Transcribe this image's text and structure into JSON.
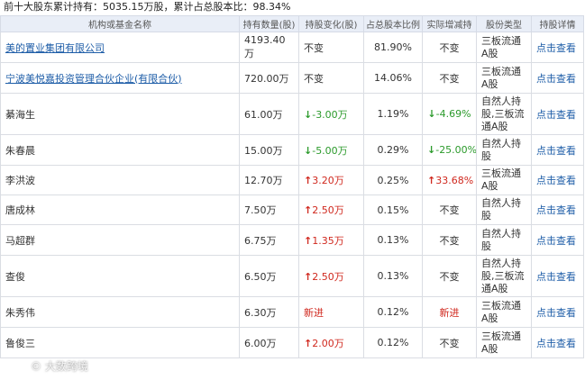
{
  "summary": {
    "title": "前十大股东累计持有：5035.15万股，累计占总股本比：98.34%"
  },
  "table": {
    "headers": [
      "机构或基金名称",
      "持有数量(股)",
      "持股变化(股)",
      "占总股本比例",
      "实际增减持",
      "股份类型",
      "持股详情"
    ],
    "rows": [
      {
        "name": "美的置业集团有限公司",
        "name_link": true,
        "qty": "4193.40万",
        "change": "不变",
        "change_dir": "none",
        "pct": "81.90%",
        "real": "不变",
        "real_dir": "none",
        "type": "三板流通A股",
        "detail": "点击查看",
        "h": 2
      },
      {
        "name": "宁波美悦嘉投资管理合伙企业(有限合伙)",
        "name_link": true,
        "qty": "720.00万",
        "change": "不变",
        "change_dir": "none",
        "pct": "14.06%",
        "real": "不变",
        "real_dir": "none",
        "type": "三板流通A股",
        "detail": "点击查看",
        "h": 2
      },
      {
        "name": "綦海生",
        "name_link": false,
        "qty": "61.00万",
        "change": "-3.00万",
        "change_dir": "down",
        "pct": "1.19%",
        "real": "-4.69%",
        "real_dir": "down",
        "type": "自然人持股,三板流通A股",
        "detail": "点击查看",
        "h": 3
      },
      {
        "name": "朱春晨",
        "name_link": false,
        "qty": "15.00万",
        "change": "-5.00万",
        "change_dir": "down",
        "pct": "0.29%",
        "real": "-25.00%",
        "real_dir": "down",
        "type": "自然人持股",
        "detail": "点击查看",
        "h": 2
      },
      {
        "name": "李洪波",
        "name_link": false,
        "qty": "12.70万",
        "change": "3.20万",
        "change_dir": "up",
        "pct": "0.25%",
        "real": "33.68%",
        "real_dir": "up",
        "type": "三板流通A股",
        "detail": "点击查看",
        "h": 1
      },
      {
        "name": "唐成林",
        "name_link": false,
        "qty": "7.50万",
        "change": "2.50万",
        "change_dir": "up",
        "pct": "0.15%",
        "real": "不变",
        "real_dir": "none",
        "type": "自然人持股",
        "detail": "点击查看",
        "h": 1
      },
      {
        "name": "马超群",
        "name_link": false,
        "qty": "6.75万",
        "change": "1.35万",
        "change_dir": "up",
        "pct": "0.13%",
        "real": "不变",
        "real_dir": "none",
        "type": "自然人持股",
        "detail": "点击查看",
        "h": 2
      },
      {
        "name": "查俊",
        "name_link": false,
        "qty": "6.50万",
        "change": "2.50万",
        "change_dir": "up",
        "pct": "0.13%",
        "real": "不变",
        "real_dir": "none",
        "type": "自然人持股,三板流通A股",
        "detail": "点击查看",
        "h": 3
      },
      {
        "name": "朱秀伟",
        "name_link": false,
        "qty": "6.30万",
        "change": "新进",
        "change_dir": "new",
        "pct": "0.12%",
        "real": "新进",
        "real_dir": "new",
        "type": "三板流通A股",
        "detail": "点击查看",
        "h": 2
      },
      {
        "name": "鲁俊三",
        "name_link": false,
        "qty": "6.00万",
        "change": "2.00万",
        "change_dir": "up",
        "pct": "0.12%",
        "real": "不变",
        "real_dir": "none",
        "type": "三板流通A股",
        "detail": "点击查看",
        "h": 2
      }
    ]
  },
  "watermark": "© 大数跨境",
  "colors": {
    "up": "#d0281e",
    "down": "#2b9a2b",
    "link": "#1f5ea8",
    "header_bg": "#e9eef7"
  }
}
